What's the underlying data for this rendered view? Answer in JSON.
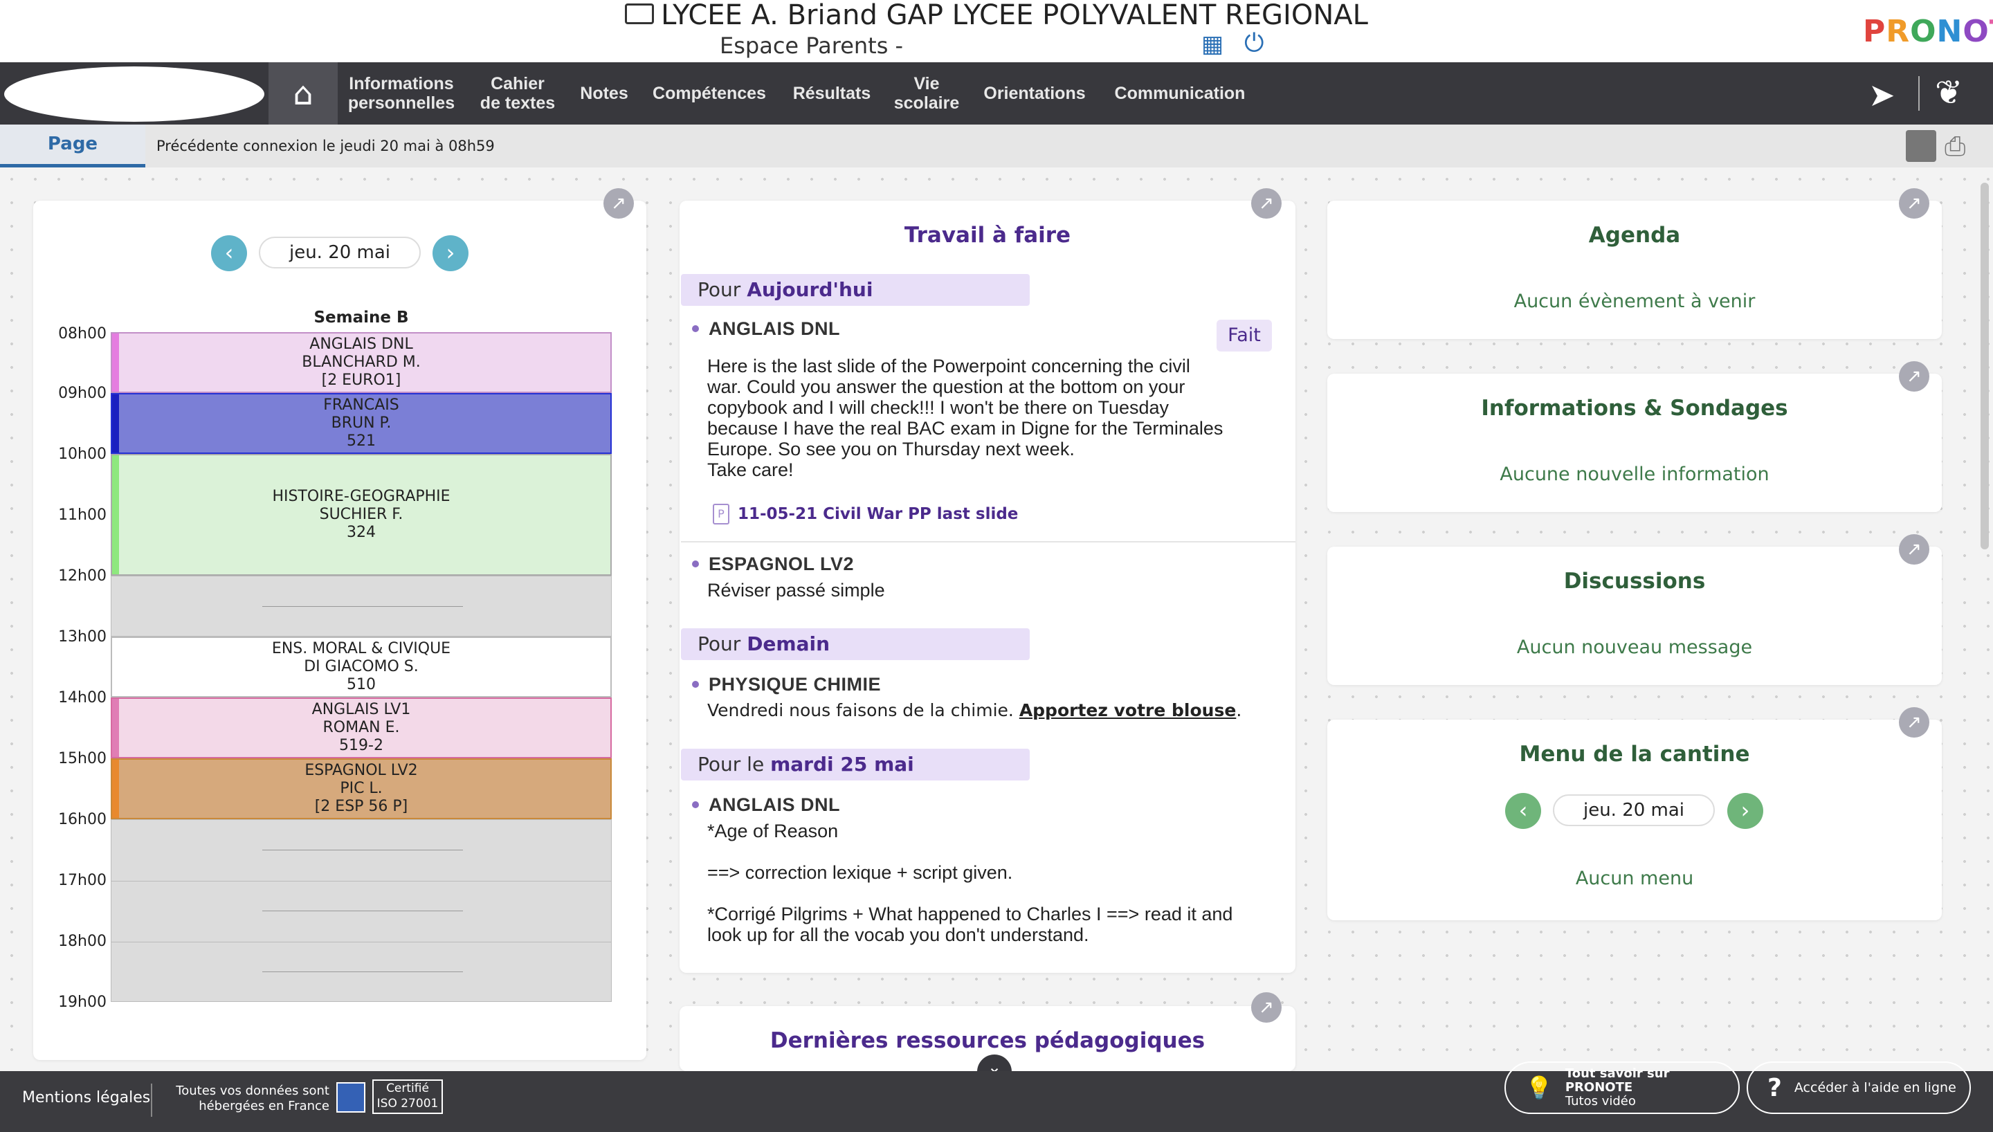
{
  "header": {
    "school_name": "LYCEE A. Briand GAP LYCEE POLYVALENT REGIONAL",
    "space": "Espace Parents -",
    "logo": "PRONOTE"
  },
  "nav": {
    "items": [
      {
        "label_line1": "Informations",
        "label_line2": "personnelles"
      },
      {
        "label_line1": "Cahier",
        "label_line2": "de textes"
      },
      {
        "label_line1": "Notes",
        "label_line2": ""
      },
      {
        "label_line1": "Compétences",
        "label_line2": ""
      },
      {
        "label_line1": "Résultats",
        "label_line2": ""
      },
      {
        "label_line1": "Vie",
        "label_line2": "scolaire"
      },
      {
        "label_line1": "Orientations",
        "label_line2": ""
      },
      {
        "label_line1": "Communication",
        "label_line2": ""
      }
    ]
  },
  "tabbar": {
    "home_tab": "Page d'accueil",
    "last_connection": "Précédente connexion le jeudi 20 mai à 08h59"
  },
  "timetable": {
    "date": "jeu. 20 mai",
    "week": "Semaine B",
    "hours": [
      "08h00",
      "09h00",
      "10h00",
      "11h00",
      "12h00",
      "13h00",
      "14h00",
      "15h00",
      "16h00",
      "17h00",
      "18h00",
      "19h00"
    ],
    "courses": [
      {
        "l1": "ANGLAIS DNL",
        "l2": "BLANCHARD M.",
        "l3": "[2 EURO1]"
      },
      {
        "l1": "FRANCAIS",
        "l2": "BRUN P.",
        "l3": "521"
      },
      {
        "l1": "HISTOIRE-GEOGRAPHIE",
        "l2": "SUCHIER F.",
        "l3": "324"
      },
      {
        "l1": "ENS. MORAL & CIVIQUE",
        "l2": "DI GIACOMO S.",
        "l3": "510"
      },
      {
        "l1": "ANGLAIS LV1",
        "l2": "ROMAN E.",
        "l3": "519-2"
      },
      {
        "l1": "ESPAGNOL LV2",
        "l2": "PIC L.",
        "l3": "[2 ESP 56 P]"
      }
    ],
    "colors": {
      "anglais_dnl": "#f0d8f0",
      "francais": "#7b7fd6",
      "histoire": "#dbf2d8",
      "anglais_lv1": "#f3d9e8",
      "espagnol": "#d6a97c"
    }
  },
  "travail": {
    "title": "Travail à faire",
    "sections": [
      {
        "prefix": "Pour ",
        "day": "Aujourd'hui"
      },
      {
        "prefix": "Pour ",
        "day": "Demain"
      },
      {
        "prefix": "Pour le ",
        "day": "mardi 25 mai"
      }
    ],
    "items": {
      "anglais_dnl_1": {
        "subject": "ANGLAIS DNL",
        "done": "Fait",
        "lines": [
          "Here is the last slide of the Powerpoint concerning the civil",
          "war. Could you answer the question at the bottom on your",
          "copybook and I will check!!! I won't be there on Tuesday",
          "because I have the real BAC exam in Digne for the Terminales",
          "Europe. So see you on Thursday next week.",
          "Take care!"
        ],
        "attachment": "11-05-21 Civil War PP last slide"
      },
      "espagnol": {
        "subject": "ESPAGNOL LV2",
        "text": "Réviser passé simple"
      },
      "physique": {
        "subject": "PHYSIQUE CHIMIE",
        "text": "Vendredi nous faisons de la chimie. ",
        "link": "Apportez votre blouse",
        "end": "."
      },
      "anglais_dnl_2": {
        "subject": "ANGLAIS DNL",
        "l1": "*Age of Reason",
        "l2": "==> correction lexique + script given.",
        "l3": "*Corrigé Pilgrims + What happened to Charles I ==> read it and",
        "l4": "look up for all the vocab you don't understand."
      }
    }
  },
  "ressources": {
    "title": "Dernières ressources pédagogiques"
  },
  "right": {
    "agenda": {
      "title": "Agenda",
      "empty": "Aucun évènement à venir"
    },
    "infos": {
      "title": "Informations & Sondages",
      "empty": "Aucune nouvelle information"
    },
    "discussions": {
      "title": "Discussions",
      "empty": "Aucun nouveau message"
    },
    "cantine": {
      "title": "Menu de la cantine",
      "date": "jeu. 20 mai",
      "empty": "Aucun menu"
    }
  },
  "footer": {
    "legal": "Mentions légales",
    "data_l1": "Toutes vos données sont",
    "data_l2": "hébergées en France",
    "cert_l1": "Certifié",
    "cert_l2": "ISO 27001",
    "tuto_l1": "Tout savoir sur PRONOTE",
    "tuto_l2": "Tutos vidéo",
    "help": "Accéder à l'aide en ligne"
  }
}
